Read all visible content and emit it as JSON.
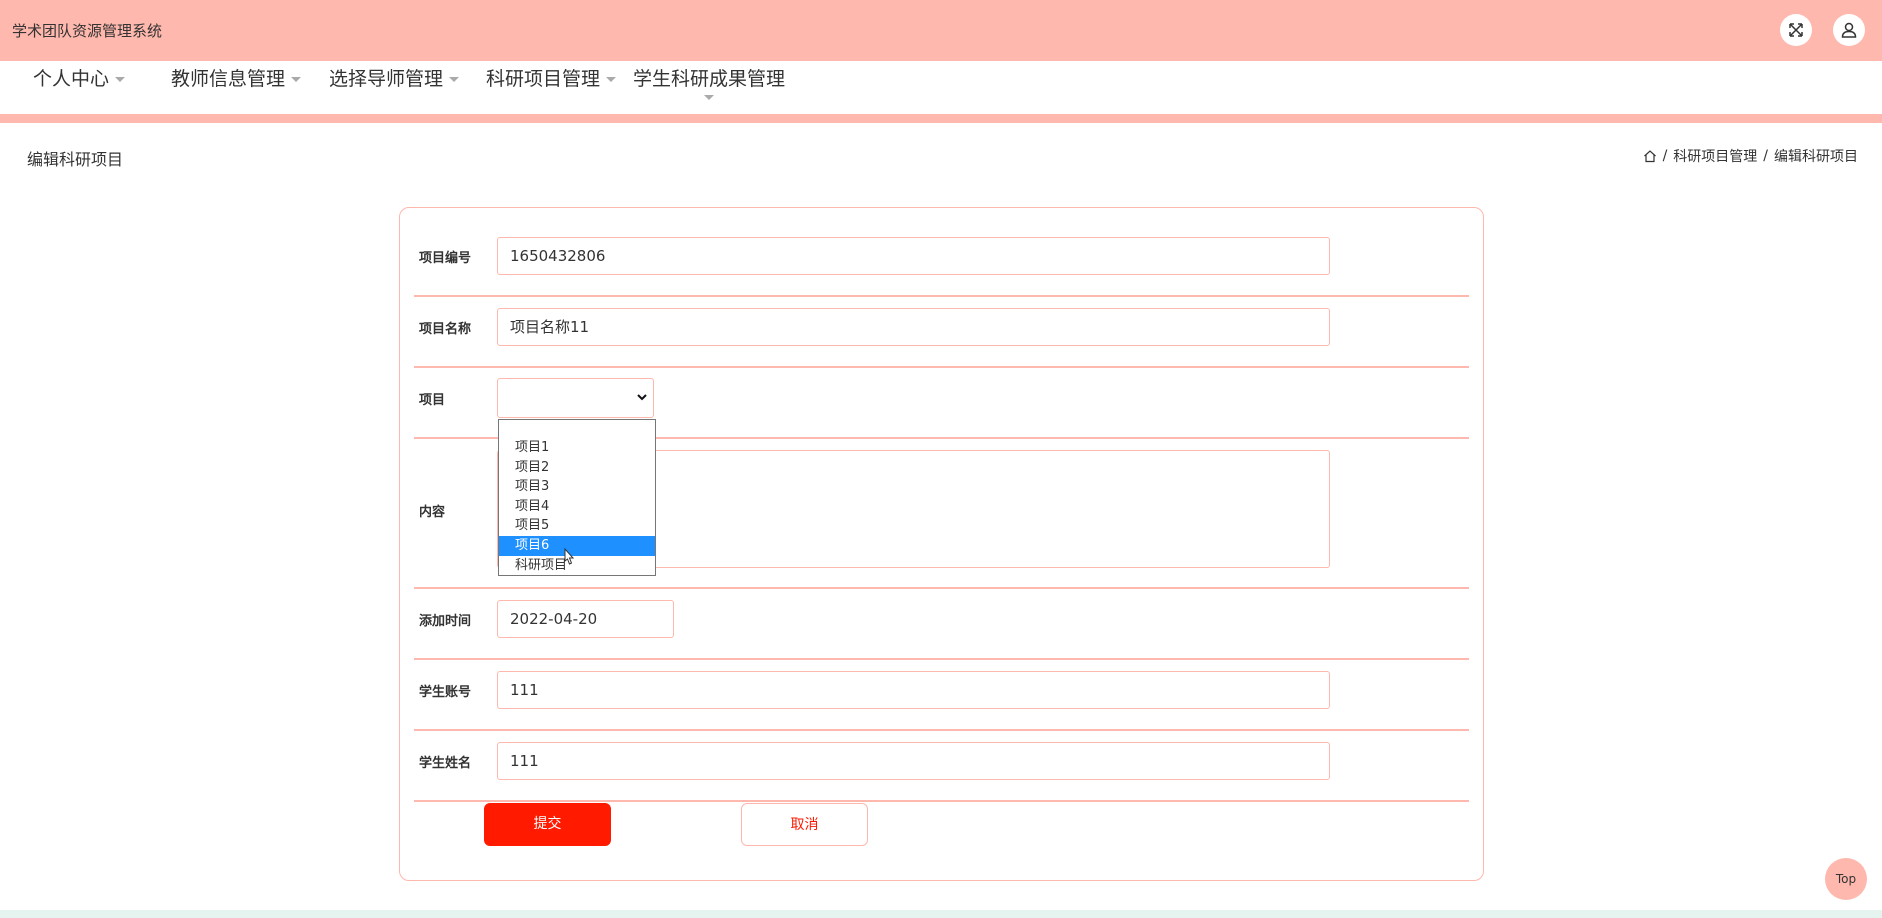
{
  "app": {
    "title": "学术团队资源管理系统"
  },
  "header_icons": {
    "fullscreen": "fullscreen-icon",
    "user": "user-icon"
  },
  "nav": {
    "items": [
      {
        "label": "个人中心"
      },
      {
        "label": "教师信息管理"
      },
      {
        "label": "选择导师管理"
      },
      {
        "label": "科研项目管理"
      },
      {
        "label": "学生科研成果管理"
      }
    ]
  },
  "page": {
    "title": "编辑科研项目",
    "breadcrumb": {
      "home_icon": "home-icon",
      "level1": "科研项目管理",
      "level2": "编辑科研项目",
      "separator": "/"
    }
  },
  "form": {
    "project_no": {
      "label": "项目编号",
      "value": "1650432806"
    },
    "project_name": {
      "label": "项目名称",
      "value": "项目名称11"
    },
    "project": {
      "label": "项目",
      "value": "",
      "options": [
        "项目1",
        "项目2",
        "项目3",
        "项目4",
        "项目5",
        "项目6",
        "科研项目"
      ],
      "highlighted": "项目6"
    },
    "content": {
      "label": "内容",
      "value": ""
    },
    "added_time": {
      "label": "添加时间",
      "value": "2022-04-20"
    },
    "student_account": {
      "label": "学生账号",
      "value": "111"
    },
    "student_name": {
      "label": "学生姓名",
      "value": "111"
    },
    "submit_label": "提交",
    "cancel_label": "取消"
  },
  "back_to_top": "Top",
  "colors": {
    "accent": "#ffb8ad",
    "primary": "#ff1a00",
    "highlight": "#1e90ff"
  }
}
